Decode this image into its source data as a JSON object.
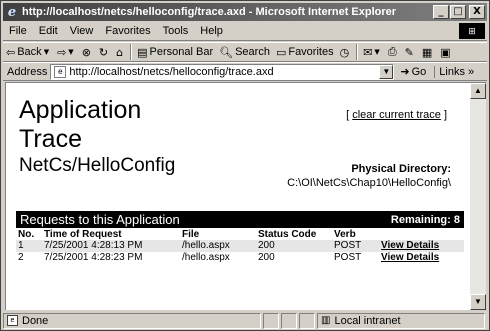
{
  "window": {
    "title": "http://localhost/netcs/helloconfig/trace.axd - Microsoft Internet Explorer"
  },
  "window_buttons": {
    "minimize": "_",
    "maximize": "□",
    "close": "X"
  },
  "menu": [
    "File",
    "Edit",
    "View",
    "Favorites",
    "Tools",
    "Help"
  ],
  "toolbar": {
    "back": "Back",
    "personal_bar": "Personal Bar",
    "search": "Search",
    "favorites": "Favorites"
  },
  "address": {
    "label": "Address",
    "value": "http://localhost/netcs/helloconfig/trace.axd",
    "go": "Go",
    "links": "Links"
  },
  "page": {
    "title_line1": "Application",
    "title_line2": "Trace",
    "subtitle": "NetCs/HelloConfig",
    "clear_open": "[",
    "clear_link": "clear current trace",
    "clear_close": "]",
    "phys_dir_label": "Physical Directory:",
    "phys_dir_value": "C:\\OI\\NetCs\\Chap10\\HelloConfig\\"
  },
  "requests": {
    "title": "Requests to this Application",
    "remaining": "Remaining: 8",
    "headers": [
      "No.",
      "Time of Request",
      "File",
      "Status Code",
      "Verb",
      ""
    ],
    "rows": [
      {
        "no": "1",
        "time": "7/25/2001 4:28:13 PM",
        "file": "/hello.aspx",
        "status": "200",
        "verb": "POST",
        "details": "View Details"
      },
      {
        "no": "2",
        "time": "7/25/2001 4:28:23 PM",
        "file": "/hello.aspx",
        "status": "200",
        "verb": "POST",
        "details": "View Details"
      }
    ]
  },
  "status": {
    "text": "Done",
    "zone": "Local intranet"
  }
}
